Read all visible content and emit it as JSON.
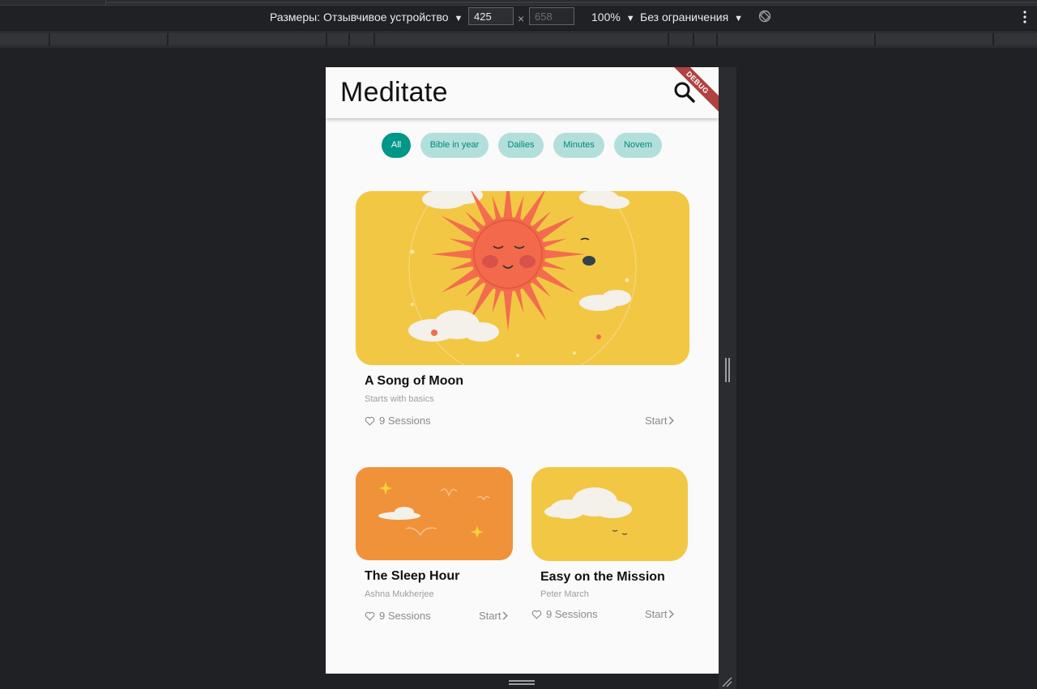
{
  "devtools": {
    "dimensions_label": "Размеры: Отзывчивое устройство",
    "width_value": "425",
    "times_sign": "×",
    "height_value": "658",
    "zoom_label": "100%",
    "throttle_label": "Без ограничения",
    "dropdown_glyph": "▼"
  },
  "app": {
    "title": "Meditate",
    "debug_banner": "DEBUG",
    "chips": [
      "All",
      "Bible in year",
      "Dailies",
      "Minutes",
      "Novem"
    ],
    "active_chip": "All",
    "accent_color": "#009688",
    "chip_color": "#b2dfdb"
  },
  "cards": [
    {
      "title": "A Song of Moon",
      "subtitle": "Starts with basics",
      "sessions": "9 Sessions",
      "start": "Start",
      "image": "sun-and-moon-illustration"
    },
    {
      "title": "The Sleep Hour",
      "subtitle": "Ashna Mukherjee",
      "sessions": "9 Sessions",
      "start": "Start",
      "image": "orange-sky-illustration"
    },
    {
      "title": "Easy on the Mission",
      "subtitle": "Peter March",
      "sessions": "9 Sessions",
      "start": "Start",
      "image": "crescent-moon-cloud-illustration"
    }
  ]
}
